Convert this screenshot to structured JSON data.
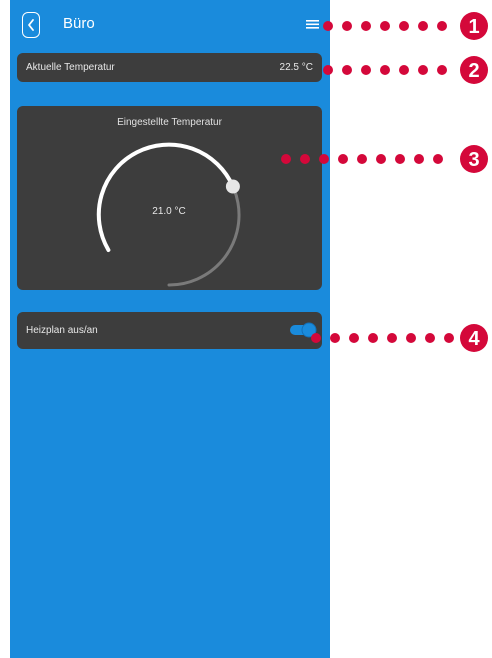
{
  "header": {
    "title": "Büro"
  },
  "current_temp": {
    "label": "Aktuelle Temperatur",
    "value": "22.5 °C"
  },
  "set_temp": {
    "label": "Eingestellte Temperatur",
    "value": "21.0 °C",
    "level": 0.62
  },
  "schedule": {
    "label": "Heizplan aus/an",
    "enabled": true
  },
  "annotations": {
    "n1": "1",
    "n2": "2",
    "n3": "3",
    "n4": "4"
  },
  "colors": {
    "background": "#1a8bdc",
    "card": "#3d3d3d",
    "annotation": "#d4083a",
    "toggle": "#1a8bdc"
  }
}
